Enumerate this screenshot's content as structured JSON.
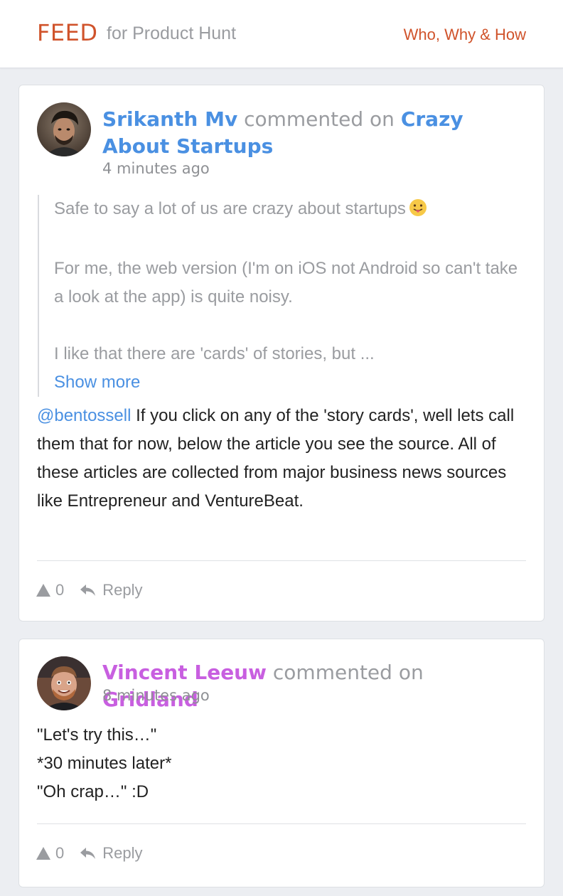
{
  "header": {
    "brand": "FEED",
    "brand_sub": "for Product Hunt",
    "nav_link": "Who, Why & How"
  },
  "colors": {
    "accent": "#d0532b",
    "link_blue": "#4a90e2",
    "link_purple": "#c85fe0",
    "muted": "#9a9ca0",
    "background": "#eceef2"
  },
  "comments": [
    {
      "user": "Srikanth Mv",
      "verb": "commented on",
      "post": "Crazy About Startups",
      "time": "4 minutes ago",
      "quote_lines": [
        "Safe to say a lot of us are crazy about startups",
        "For me, the web version (I'm on iOS not Android so can't take a look at the app) is quite noisy.",
        "I like that there are 'cards' of stories, but ..."
      ],
      "quote_emoji": "tongue-out-emoji",
      "show_more": "Show more",
      "mention": "@bentossell",
      "body": "If you click on any of the 'story cards', well lets call them that for now, below the article you see the source. All of these articles are collected from major business news sources like Entrepreneur and VentureBeat.",
      "votes": "0",
      "reply_label": "Reply",
      "vote_icon": "upvote-triangle-icon",
      "reply_icon": "reply-arrow-icon"
    },
    {
      "user": "Vincent Leeuw",
      "verb": "commented on",
      "post": "Gridland",
      "time": "8 minutes ago",
      "body_lines": [
        "\"Let's try this…\"",
        "*30 minutes later*",
        "\"Oh crap…\" :D"
      ],
      "votes": "0",
      "reply_label": "Reply",
      "vote_icon": "upvote-triangle-icon",
      "reply_icon": "reply-arrow-icon"
    }
  ]
}
